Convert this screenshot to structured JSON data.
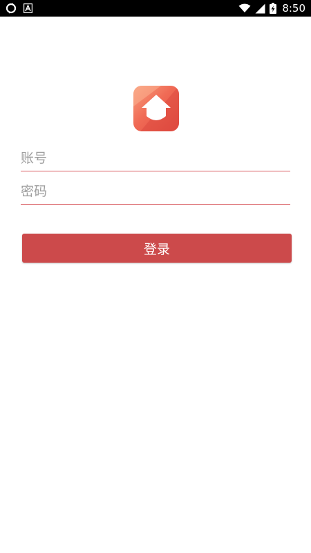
{
  "status_bar": {
    "time": "8:50",
    "icons": [
      "sync-icon",
      "text-a-icon",
      "wifi-icon",
      "signal-icon",
      "battery-charging-icon"
    ]
  },
  "app": {
    "logo_icon": "house-logo-icon",
    "brand_color": "#cc4a4b"
  },
  "form": {
    "account_placeholder": "账号",
    "account_value": "",
    "password_placeholder": "密码",
    "password_value": "",
    "login_label": "登录"
  }
}
